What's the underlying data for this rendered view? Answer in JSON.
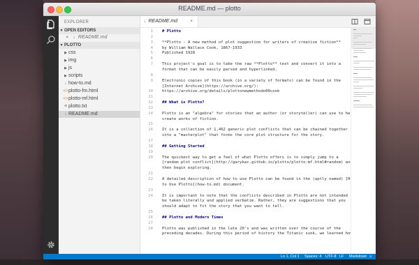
{
  "window": {
    "title": "README.md — plotto"
  },
  "sidebar": {
    "title": "EXPLORER",
    "open_editors": {
      "label": "OPEN EDITORS",
      "items": [
        {
          "close": "×",
          "label": "README.md"
        }
      ]
    },
    "project": {
      "label": "PLOTTO",
      "items": [
        {
          "type": "folder",
          "label": "css"
        },
        {
          "type": "folder",
          "label": "img"
        },
        {
          "type": "folder",
          "label": "js"
        },
        {
          "type": "folder",
          "label": "scripts"
        },
        {
          "type": "file",
          "label": "how-to.md",
          "icon": "markdown-icon"
        },
        {
          "type": "file",
          "label": "plotto-fm.html",
          "icon": "html-icon"
        },
        {
          "type": "file",
          "label": "plotto-mf.html",
          "icon": "html-icon"
        },
        {
          "type": "file",
          "label": "plotto.txt",
          "icon": "text-icon"
        },
        {
          "type": "file",
          "label": "README.md",
          "icon": "markdown-icon",
          "selected": true
        }
      ]
    }
  },
  "tabs": [
    {
      "label": "README.md",
      "close": "×"
    }
  ],
  "editor": {
    "lines": [
      {
        "n": "1",
        "text": "# Plotto"
      },
      {
        "n": "2",
        "text": ""
      },
      {
        "n": "3",
        "text": "**Plotto - A new method of plot suggestion for writers of creative fiction**"
      },
      {
        "n": "4",
        "text": "by William Wallace Cook, 1867-1933"
      },
      {
        "n": "5",
        "text": "Published 1928"
      },
      {
        "n": "6",
        "text": ""
      },
      {
        "n": "7",
        "text": "This project's goal is to take the raw **Plotto** text and convert it into a"
      },
      {
        "n": "",
        "text": "format that can be easily parsed and hyperlinked."
      },
      {
        "n": "8",
        "text": ""
      },
      {
        "n": "9",
        "text": "Electronic copies of this book (in a variety of formats) can be found in the"
      },
      {
        "n": "",
        "text": "[Internet Archive](https://archive.org/):"
      },
      {
        "n": "10",
        "text": "https://archive.org/details/plottonewmethodo00cook"
      },
      {
        "n": "11",
        "text": ""
      },
      {
        "n": "12",
        "text": "## What is Plotto?"
      },
      {
        "n": "13",
        "text": ""
      },
      {
        "n": "14",
        "text": "Plotto is an \"algebra\" for stories that an author (or storyteller) can use to help"
      },
      {
        "n": "",
        "text": "create works of fiction."
      },
      {
        "n": "15",
        "text": ""
      },
      {
        "n": "16",
        "text": "It is a collection of 1,462 generic plot conflicts that can be chained together"
      },
      {
        "n": "",
        "text": "into a \"masterplot\" that forms the core plot structure for the story."
      },
      {
        "n": "17",
        "text": ""
      },
      {
        "n": "18",
        "text": "## Getting Started"
      },
      {
        "n": "19",
        "text": ""
      },
      {
        "n": "20",
        "text": "The quickest way to get a feel of what Plotto offers is to simply jump to a"
      },
      {
        "n": "",
        "text": "[random plot conflict](http://garykac.github.io/plotto/plotto-mf.html#random) and"
      },
      {
        "n": "",
        "text": "then begin exploring."
      },
      {
        "n": "21",
        "text": ""
      },
      {
        "n": "22",
        "text": "A detailed description of how to use Plotto can be found in the (aptly named) [How"
      },
      {
        "n": "",
        "text": "to Use Plotto](how-to.md) document."
      },
      {
        "n": "23",
        "text": ""
      },
      {
        "n": "24",
        "text": "It is important to note that the conflicts described in Plotto are not intended to"
      },
      {
        "n": "",
        "text": "be taken literally and applied verbatim. Rather, they are suggestions that you"
      },
      {
        "n": "",
        "text": "should adapt to fit the story that you want to tell."
      },
      {
        "n": "25",
        "text": ""
      },
      {
        "n": "26",
        "text": "## Plotto and Modern Times"
      },
      {
        "n": "27",
        "text": ""
      },
      {
        "n": "28",
        "text": "Plotto was published in the late 20's and was written over the course of the"
      },
      {
        "n": "",
        "text": "preceding decades. During this period of history the Titanic sunk, we learned how"
      }
    ]
  },
  "statusbar": {
    "position": "Ln 1, Col 1",
    "spaces": "Spaces: 4",
    "encoding": "UTF-8",
    "eol": "LF",
    "language": "Markdown",
    "feedback_icon": "smiley-icon"
  }
}
